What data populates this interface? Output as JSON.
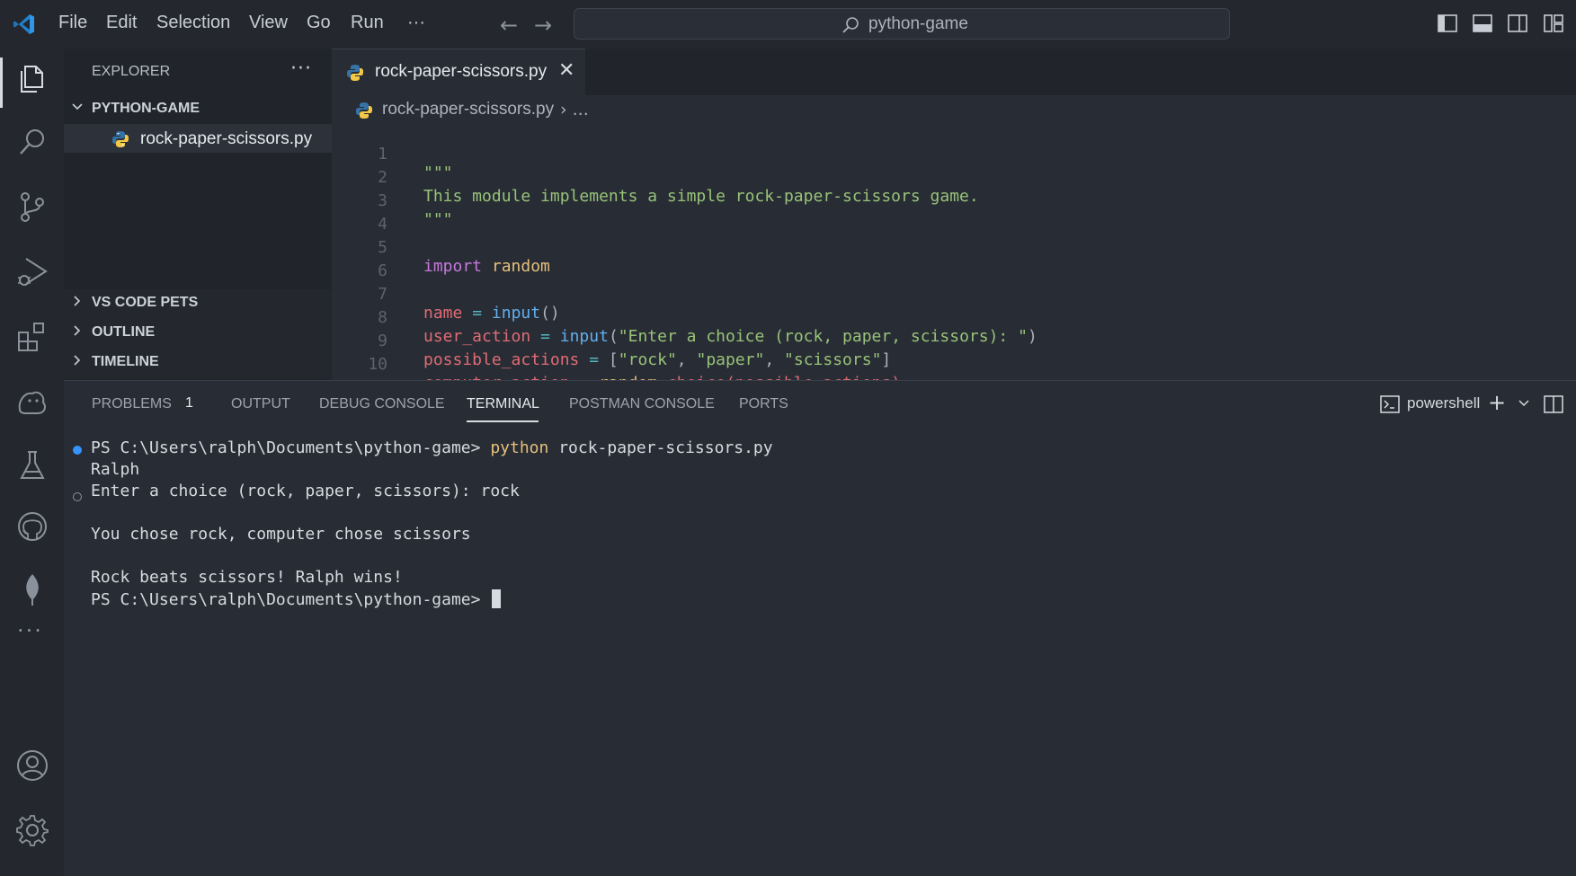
{
  "titlebar": {
    "menus": [
      "File",
      "Edit",
      "Selection",
      "View",
      "Go",
      "Run",
      "···"
    ],
    "search_label": "python-game",
    "accent": "#2f97e6"
  },
  "activity_bar": {
    "items": [
      "explorer-icon",
      "search-icon",
      "source-control-icon",
      "run-debug-icon",
      "extensions-icon",
      "pets-icon",
      "testing-icon",
      "github-icon",
      "mongodb-icon",
      "more-icon",
      "account-icon",
      "settings-icon"
    ],
    "more_label": "···"
  },
  "sidebar": {
    "title": "EXPLORER",
    "more": "···",
    "folder": "PYTHON-GAME",
    "file": "rock-paper-scissors.py",
    "sections": [
      "VS CODE PETS",
      "OUTLINE",
      "TIMELINE"
    ]
  },
  "editor": {
    "tab_label": "rock-paper-scissors.py",
    "tab_close": "✕",
    "breadcrumb_file": "rock-paper-scissors.py",
    "breadcrumb_sep": "› ...",
    "line_numbers": [
      "1",
      "2",
      "3",
      "4",
      "5",
      "6",
      "7",
      "8",
      "9",
      "10"
    ],
    "lines": [
      {
        "n": "1",
        "text": "\"\"\""
      },
      {
        "n": "2",
        "text": "This module implements a simple rock-paper-scissors game."
      },
      {
        "n": "3",
        "text": "\"\"\""
      },
      {
        "n": "4",
        "text": ""
      },
      {
        "n": "5",
        "text": "import random"
      },
      {
        "n": "6",
        "text": ""
      },
      {
        "n": "7",
        "text": "name = input()"
      },
      {
        "n": "8",
        "text": "user_action = input(\"Enter a choice (rock, paper, scissors): \")"
      },
      {
        "n": "9",
        "text": "possible_actions = [\"rock\", \"paper\", \"scissors\"]"
      },
      {
        "n": "10",
        "text": "computer_action = random.choice(possible_actions)"
      }
    ],
    "tokens": {
      "l1": "\"\"\"",
      "l2": "This module implements a simple rock-paper-scissors game.",
      "l3": "\"\"\"",
      "l5_kw": "import",
      "l5_mod": "random",
      "l7_var": "name",
      "l7_op": "=",
      "l7_fn": "input",
      "l7_punc": "()",
      "l8_var": "user_action",
      "l8_op": "=",
      "l8_fn": "input",
      "l8_p1": "(",
      "l8_str": "\"Enter a choice (rock, paper, scissors): \"",
      "l8_p2": ")",
      "l9_var": "possible_actions",
      "l9_op": "=",
      "l9_p1": "[",
      "l9_s1": "\"rock\"",
      "l9_c1": ", ",
      "l9_s2": "\"paper\"",
      "l9_c2": ", ",
      "l9_s3": "\"scissors\"",
      "l9_p2": "]",
      "l10_var": "computer_action",
      "l10_op": "=",
      "l10_mod": "random",
      "l10_dot": ".",
      "l10_fn": "choice",
      "l10_p1": "(",
      "l10_arg": "possible_actions",
      "l10_p2": ")"
    }
  },
  "panel": {
    "tabs": [
      "PROBLEMS",
      "OUTPUT",
      "DEBUG CONSOLE",
      "TERMINAL",
      "POSTMAN CONSOLE",
      "PORTS"
    ],
    "active_tab": "TERMINAL",
    "problems_count": "1",
    "terminal_type": "powershell",
    "add_label": "+",
    "terminal": {
      "prompt1": "PS C:\\Users\\ralph\\Documents\\python-game> ",
      "cmd1": "python",
      "args1": " rock-paper-scissors.py",
      "out1": "Ralph",
      "out2": "Enter a choice (rock, paper, scissors): rock",
      "out3": "You chose rock, computer chose scissors",
      "out4": "Rock beats scissors! Ralph wins!",
      "prompt2": "PS C:\\Users\\ralph\\Documents\\python-game> "
    }
  }
}
